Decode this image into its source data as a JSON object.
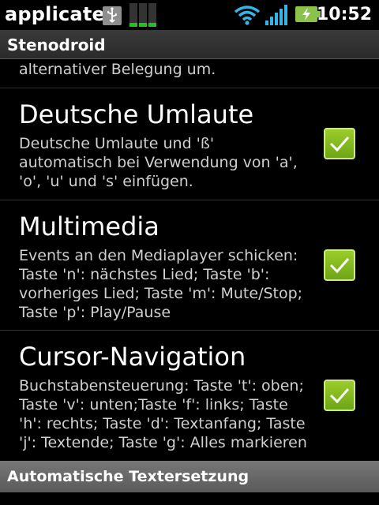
{
  "status_bar": {
    "app_name": "applicate",
    "time": "10:52",
    "icons": [
      "usb-icon",
      "cpu-usage-icon",
      "wifi-icon",
      "signal-icon",
      "battery-charging-icon"
    ]
  },
  "title_bar": {
    "title": "Stenodroid"
  },
  "partial_text": "alternativer Belegung um.",
  "items": [
    {
      "title": "Deutsche Umlaute",
      "summary": "Deutsche Umlaute und 'ß' automatisch bei Verwendung von 'a', 'o', 'u' und 's' einfügen.",
      "checked": true
    },
    {
      "title": "Multimedia",
      "summary": "Events an den Mediaplayer schicken: Taste 'n': nächstes Lied; Taste 'b': vorheriges Lied; Taste 'm': Mute/Stop; Taste 'p': Play/Pause",
      "checked": true
    },
    {
      "title": "Cursor-Navigation",
      "summary": "Buchstabensteuerung: Taste 't': oben; Taste 'v': unten;Taste 'f': links; Taste 'h': rechts; Taste 'd': Textanfang; Taste 'j': Textende; Taste 'g': Alles markieren",
      "checked": true
    }
  ],
  "section_header": {
    "title": "Automatische Textersetzung"
  },
  "colors": {
    "checkbox_green": "#7ab51d",
    "wifi_blue": "#33b5e5",
    "battery_green": "#8bc34a"
  }
}
